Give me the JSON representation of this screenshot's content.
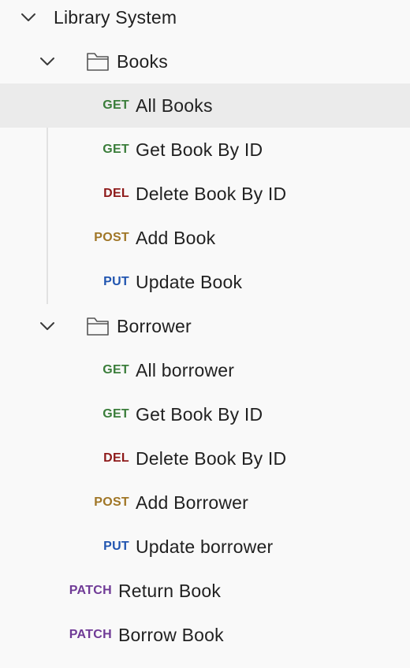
{
  "collection": {
    "name": "Library System"
  },
  "folders": [
    {
      "name": "Books",
      "requests": [
        {
          "method": "GET",
          "name": "All Books",
          "selected": true
        },
        {
          "method": "GET",
          "name": "Get Book By ID"
        },
        {
          "method": "DEL",
          "name": "Delete Book By ID"
        },
        {
          "method": "POST",
          "name": "Add Book"
        },
        {
          "method": "PUT",
          "name": "Update Book"
        }
      ]
    },
    {
      "name": "Borrower",
      "requests": [
        {
          "method": "GET",
          "name": "All borrower"
        },
        {
          "method": "GET",
          "name": "Get Book By ID"
        },
        {
          "method": "DEL",
          "name": "Delete Book By ID"
        },
        {
          "method": "POST",
          "name": "Add Borrower"
        },
        {
          "method": "PUT",
          "name": "Update borrower"
        }
      ]
    }
  ],
  "root_requests": [
    {
      "method": "PATCH",
      "name": "Return Book"
    },
    {
      "method": "PATCH",
      "name": "Borrow Book"
    }
  ],
  "icons": {
    "expand": "chevron-down-icon",
    "folder": "folder-icon"
  },
  "method_colors": {
    "GET": "#3a7d3a",
    "DEL": "#8e1a1a",
    "POST": "#a07626",
    "PUT": "#2155b0",
    "PATCH": "#6f3a96"
  },
  "selected_background": "#ebebeb"
}
